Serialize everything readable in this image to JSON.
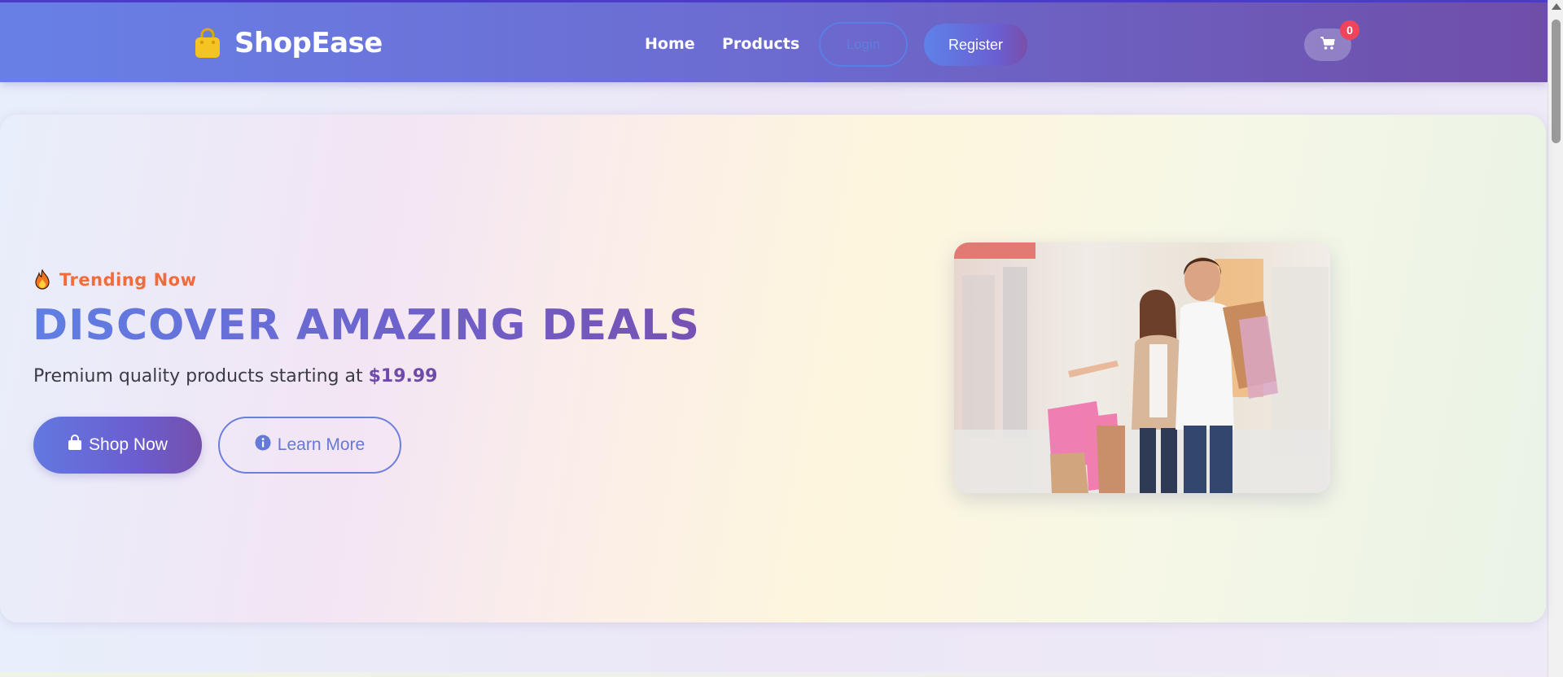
{
  "navbar": {
    "brand": "ShopEase",
    "brand_icon": "shopping-bag-icon",
    "links": [
      {
        "label": "Home"
      },
      {
        "label": "Products"
      }
    ],
    "login_label": "Login",
    "register_label": "Register",
    "cart_icon": "cart-icon",
    "cart_count": "0"
  },
  "hero": {
    "trending_icon": "fire-icon",
    "trending_label": "Trending Now",
    "headline": "DISCOVER AMAZING DEALS",
    "subtitle_prefix": "Premium quality products starting at",
    "price": "$19.99",
    "shop_button_label": "Shop Now",
    "learn_button_label": "Learn More",
    "image_alt": "Couple shopping with bags in a mall"
  },
  "colors": {
    "accent_blue": "#6278e0",
    "accent_purple": "#7450ac",
    "trending_orange": "#f26b3a",
    "badge_red": "#f0445a",
    "brand_yellow": "#f6c324"
  }
}
